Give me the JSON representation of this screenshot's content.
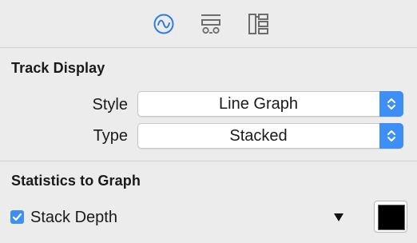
{
  "toolbar": {
    "icons": [
      "waveform-icon",
      "track-layout-icon",
      "hierarchy-icon"
    ],
    "accent": "#2f7de1"
  },
  "track_display": {
    "heading": "Track Display",
    "style_label": "Style",
    "style_value": "Line Graph",
    "type_label": "Type",
    "type_value": "Stacked"
  },
  "statistics": {
    "heading": "Statistics to Graph",
    "items": [
      {
        "label": "Stack Depth",
        "checked": true,
        "color": "#000000"
      }
    ]
  },
  "colors": {
    "accent": "#3d8ef5",
    "background": "#ececec"
  }
}
